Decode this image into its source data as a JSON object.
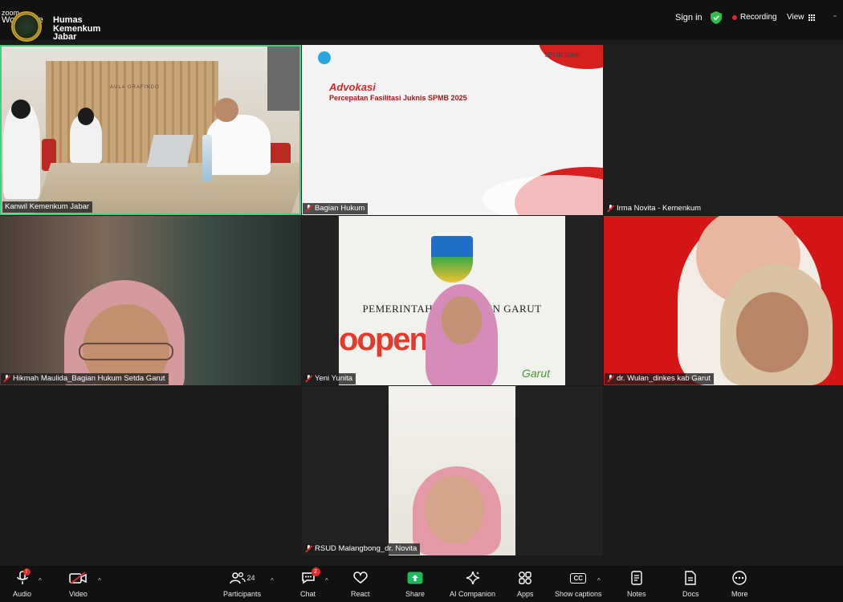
{
  "topbar": {
    "zoom_line1": "zoom",
    "zoom_line2": "Workplace",
    "org_line1": "Humas",
    "org_line2": "Kemenkum",
    "org_line3": "Jabar",
    "sign_in": "Sign in",
    "recording": "Recording",
    "view": "View",
    "minimize": "-",
    "colors": {
      "secure": "#2fbf4a",
      "recording_dot": "#e02828"
    }
  },
  "tiles": [
    {
      "name": "Kanwil Kemenkum Jabar",
      "muted": false,
      "active_speaker": true,
      "room_sign": "AULA GRAFINDO"
    },
    {
      "name": "Bagian Hukum",
      "muted": true,
      "slide_title": "Advokasi",
      "slide_subtitle": "Percepatan Fasilitasi Juknis SPMB 2025",
      "slide_logo": "SPMB Jabar"
    },
    {
      "name": "Irma Novita - Kemenkum",
      "muted": true
    },
    {
      "name": "Hikmah Maulida_Bagian Hukum Setda Garut",
      "muted": true
    },
    {
      "name": "Yeni Yunita",
      "muted": true,
      "backdrop_text": "PEMERINTAH KABUPATEN GARUT",
      "backdrop_script": "Garut"
    },
    {
      "name": "dr. Wulan_dinkes kab Garut",
      "muted": true
    },
    {
      "name": "RSUD Malangbong_dr. Novita",
      "muted": true
    }
  ],
  "toolbar": {
    "audio": "Audio",
    "video": "Video",
    "participants": "Participants",
    "participants_count": "24",
    "chat": "Chat",
    "chat_badge": "2",
    "react": "React",
    "share": "Share",
    "ai_companion": "AI Companion",
    "apps": "Apps",
    "captions": "Show captions",
    "captions_icon": "CC",
    "notes": "Notes",
    "docs": "Docs",
    "more": "More",
    "colors": {
      "share": "#1fb85a",
      "alert": "#e02828"
    }
  }
}
